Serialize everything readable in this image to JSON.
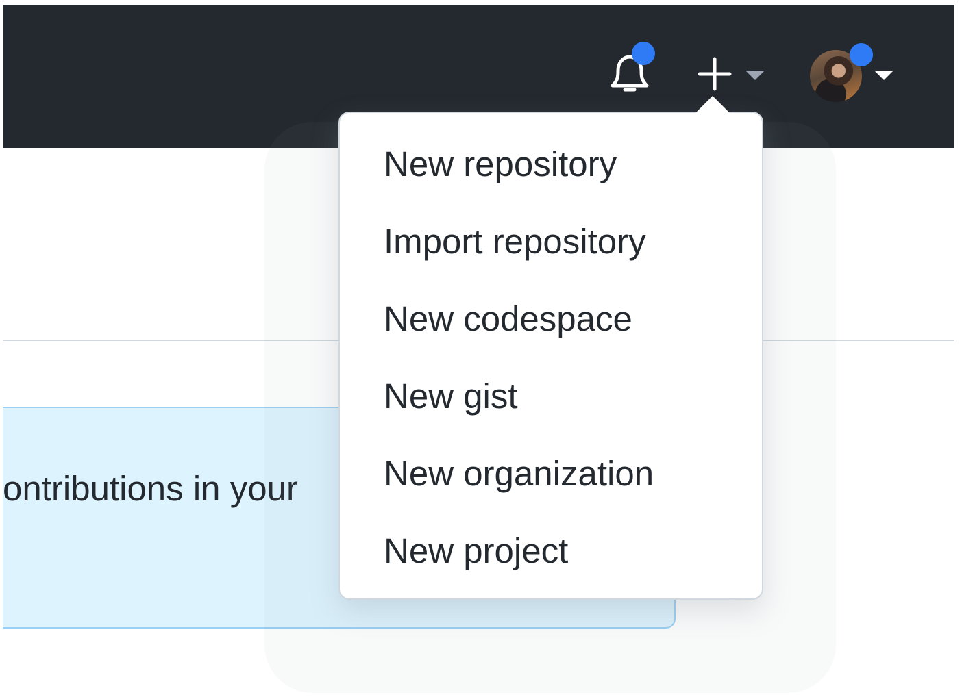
{
  "header": {
    "notifications_icon": "bell-icon",
    "create_icon": "plus-icon",
    "avatar_alt": "user-avatar",
    "colors": {
      "background": "#24292f",
      "unread_dot": "#2f7bf6"
    }
  },
  "create_menu": {
    "items": [
      {
        "label": "New repository"
      },
      {
        "label": "Import repository"
      },
      {
        "label": "New codespace"
      },
      {
        "label": "New gist"
      },
      {
        "label": "New organization"
      },
      {
        "label": "New project"
      }
    ]
  },
  "banner": {
    "text": "ontributions in your",
    "colors": {
      "background": "#ddf4ff",
      "border": "#9ad0f5"
    }
  }
}
